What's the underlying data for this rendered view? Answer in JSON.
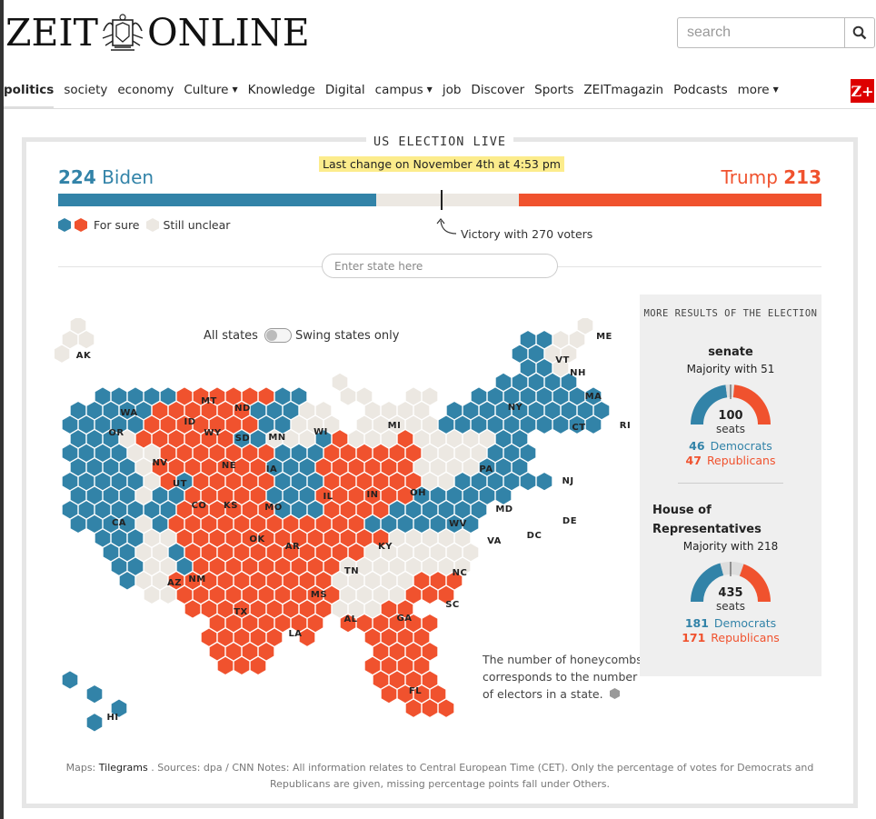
{
  "brand": {
    "name_left": "ZEIT",
    "name_right": "ONLINE",
    "zplus": "Z+"
  },
  "search": {
    "placeholder": "search"
  },
  "nav": [
    {
      "label": "politics",
      "active": true,
      "dropdown": false
    },
    {
      "label": "society",
      "dropdown": false
    },
    {
      "label": "economy",
      "dropdown": false
    },
    {
      "label": "Culture",
      "dropdown": true
    },
    {
      "label": "Knowledge",
      "dropdown": false
    },
    {
      "label": "Digital",
      "dropdown": false
    },
    {
      "label": "campus",
      "dropdown": true
    },
    {
      "label": "job",
      "dropdown": false
    },
    {
      "label": "Discover",
      "dropdown": false
    },
    {
      "label": "Sports",
      "dropdown": false
    },
    {
      "label": "ZEITmagazin",
      "dropdown": false
    },
    {
      "label": "Podcasts",
      "dropdown": false
    },
    {
      "label": "more",
      "dropdown": true
    }
  ],
  "election": {
    "title": "US ELECTION LIVE",
    "last_change": "Last change on November 4th at 4:53 pm",
    "biden": {
      "votes": "224",
      "name": "Biden"
    },
    "trump": {
      "votes": "213",
      "name": "Trump"
    },
    "bar": {
      "total": 538,
      "dem": 224,
      "rep": 213,
      "threshold": 270
    },
    "legend_sure": "For sure",
    "legend_unclear": "Still unclear",
    "victory_label": "Victory with 270 voters",
    "state_input_placeholder": "Enter state here",
    "toggle_left": "All states",
    "toggle_right": "Swing states only",
    "note": "The number of honeycombs corresponds to the number of electors in a state.",
    "colors": {
      "dem": "#3283a8",
      "rep": "#f0522e",
      "unclear": "#ece8e2",
      "highlight": "#fcec8c"
    }
  },
  "map_states": [
    {
      "id": "AK",
      "label": "AK",
      "status": "unclear"
    },
    {
      "id": "WA",
      "label": "WA",
      "status": "dem"
    },
    {
      "id": "OR",
      "label": "OR",
      "status": "dem"
    },
    {
      "id": "CA",
      "label": "CA",
      "status": "dem"
    },
    {
      "id": "NV",
      "label": "NV",
      "status": "unclear"
    },
    {
      "id": "ID",
      "label": "ID",
      "status": "rep"
    },
    {
      "id": "MT",
      "label": "MT",
      "status": "rep"
    },
    {
      "id": "WY",
      "label": "WY",
      "status": "rep"
    },
    {
      "id": "UT",
      "label": "UT",
      "status": "rep"
    },
    {
      "id": "AZ",
      "label": "AZ",
      "status": "unclear"
    },
    {
      "id": "CO",
      "label": "CO",
      "status": "dem"
    },
    {
      "id": "NM",
      "label": "NM",
      "status": "dem"
    },
    {
      "id": "ND",
      "label": "ND",
      "status": "rep"
    },
    {
      "id": "SD",
      "label": "SD",
      "status": "rep"
    },
    {
      "id": "NE",
      "label": "NE",
      "status": "rep"
    },
    {
      "id": "KS",
      "label": "KS",
      "status": "rep"
    },
    {
      "id": "OK",
      "label": "OK",
      "status": "rep"
    },
    {
      "id": "TX",
      "label": "TX",
      "status": "rep"
    },
    {
      "id": "MN",
      "label": "MN",
      "status": "dem"
    },
    {
      "id": "IA",
      "label": "IA",
      "status": "rep"
    },
    {
      "id": "MO",
      "label": "MO",
      "status": "rep"
    },
    {
      "id": "AR",
      "label": "AR",
      "status": "rep"
    },
    {
      "id": "LA",
      "label": "LA",
      "status": "rep"
    },
    {
      "id": "WI",
      "label": "WI",
      "status": "unclear"
    },
    {
      "id": "IL",
      "label": "IL",
      "status": "dem"
    },
    {
      "id": "MI",
      "label": "MI",
      "status": "unclear"
    },
    {
      "id": "IN",
      "label": "IN",
      "status": "rep"
    },
    {
      "id": "OH",
      "label": "OH",
      "status": "rep"
    },
    {
      "id": "KY",
      "label": "KY",
      "status": "rep"
    },
    {
      "id": "TN",
      "label": "TN",
      "status": "rep"
    },
    {
      "id": "MS",
      "label": "MS",
      "status": "rep"
    },
    {
      "id": "AL",
      "label": "AL",
      "status": "rep"
    },
    {
      "id": "GA",
      "label": "GA",
      "status": "unclear"
    },
    {
      "id": "FL",
      "label": "FL",
      "status": "rep"
    },
    {
      "id": "SC",
      "label": "SC",
      "status": "rep"
    },
    {
      "id": "NC",
      "label": "NC",
      "status": "unclear"
    },
    {
      "id": "VA",
      "label": "VA",
      "status": "dem"
    },
    {
      "id": "WV",
      "label": "WV",
      "status": "rep"
    },
    {
      "id": "PA",
      "label": "PA",
      "status": "unclear"
    },
    {
      "id": "MD",
      "label": "MD",
      "status": "dem"
    },
    {
      "id": "DC",
      "label": "DC",
      "status": "dem"
    },
    {
      "id": "DE",
      "label": "DE",
      "status": "dem"
    },
    {
      "id": "NJ",
      "label": "NJ",
      "status": "dem"
    },
    {
      "id": "NY",
      "label": "NY",
      "status": "dem"
    },
    {
      "id": "VT",
      "label": "VT",
      "status": "dem"
    },
    {
      "id": "NH",
      "label": "NH",
      "status": "dem"
    },
    {
      "id": "MA",
      "label": "MA",
      "status": "dem"
    },
    {
      "id": "CT",
      "label": "CT",
      "status": "dem"
    },
    {
      "id": "RI",
      "label": "RI",
      "status": "dem"
    },
    {
      "id": "ME",
      "label": "ME",
      "status": "unclear"
    },
    {
      "id": "HI",
      "label": "HI",
      "status": "dem"
    }
  ],
  "results": {
    "head": "MORE RESULTS OF THE ELECTION",
    "senate": {
      "title": "senate",
      "majority": "Majority with 51",
      "seats": "100",
      "seats_label": "seats",
      "total": 100,
      "dem": 46,
      "rep": 47,
      "dem_count": "46",
      "dem_label": "Democrats",
      "rep_count": "47",
      "rep_label": "Republicans"
    },
    "house": {
      "title": "House of Representatives",
      "majority": "Majority with 218",
      "seats": "435",
      "seats_label": "seats",
      "total": 435,
      "dem": 181,
      "rep": 171,
      "dem_count": "181",
      "dem_label": "Democrats",
      "rep_count": "171",
      "rep_label": "Republicans"
    }
  },
  "footer": {
    "maps_prefix": "Maps:",
    "maps_link": "Tilegrams",
    "text": ". Sources: dpa / CNN Notes: All information relates to Central European Time (CET). Only the percentage of votes for Democrats and Republicans are given, missing percentage points fall under Others."
  }
}
